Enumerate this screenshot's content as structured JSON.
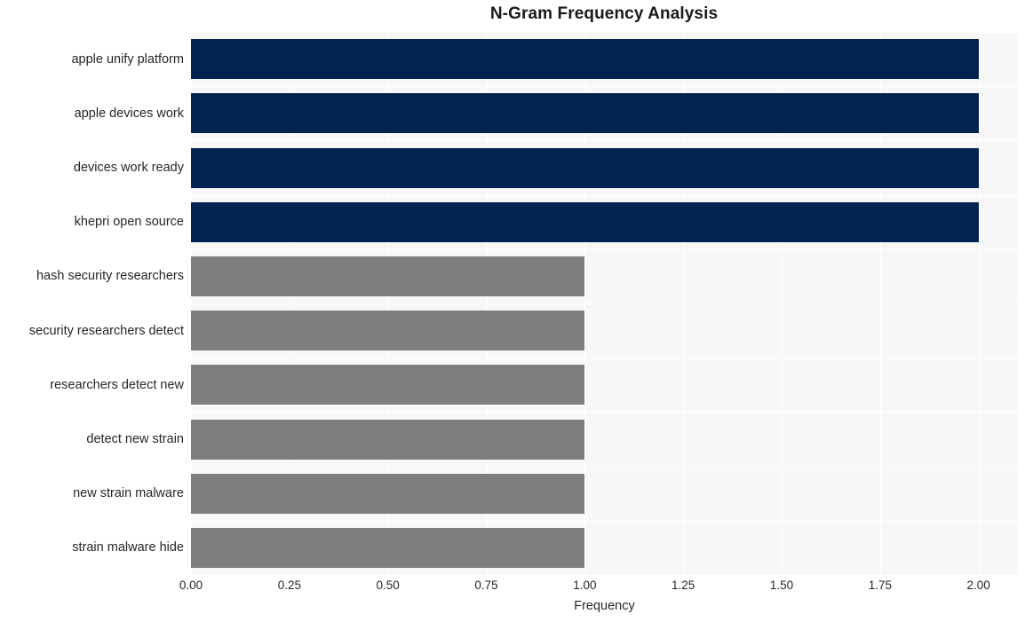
{
  "chart_data": {
    "type": "bar",
    "orientation": "horizontal",
    "title": "N-Gram Frequency Analysis",
    "xlabel": "Frequency",
    "ylabel": "",
    "categories": [
      "apple unify platform",
      "apple devices work",
      "devices work ready",
      "khepri open source",
      "hash security researchers",
      "security researchers detect",
      "researchers detect new",
      "detect new strain",
      "new strain malware",
      "strain malware hide"
    ],
    "values": [
      2,
      2,
      2,
      2,
      1,
      1,
      1,
      1,
      1,
      1
    ],
    "bar_colors": [
      "#01234f",
      "#01234f",
      "#01234f",
      "#01234f",
      "#7f7e7c",
      "#7f7e7c",
      "#7f7e7c",
      "#7f7e7c",
      "#7f7e7c",
      "#7f7e7c"
    ],
    "xlim": [
      0.0,
      2.1
    ],
    "xticks": [
      0.0,
      0.25,
      0.5,
      0.75,
      1.0,
      1.25,
      1.5,
      1.75,
      2.0
    ],
    "xticklabels": [
      "0.00",
      "0.25",
      "0.50",
      "0.75",
      "1.00",
      "1.25",
      "1.50",
      "1.75",
      "2.00"
    ],
    "grid": true,
    "grid_color": "#ffffff",
    "plot_background": "#f7f7f7",
    "figure_background": "#ffffff",
    "legend": null,
    "annotations": []
  },
  "colors": {
    "high_frequency": "#01234f",
    "low_frequency": "#7f7e7c",
    "text": "#262626",
    "title": "#1a1a1a"
  }
}
